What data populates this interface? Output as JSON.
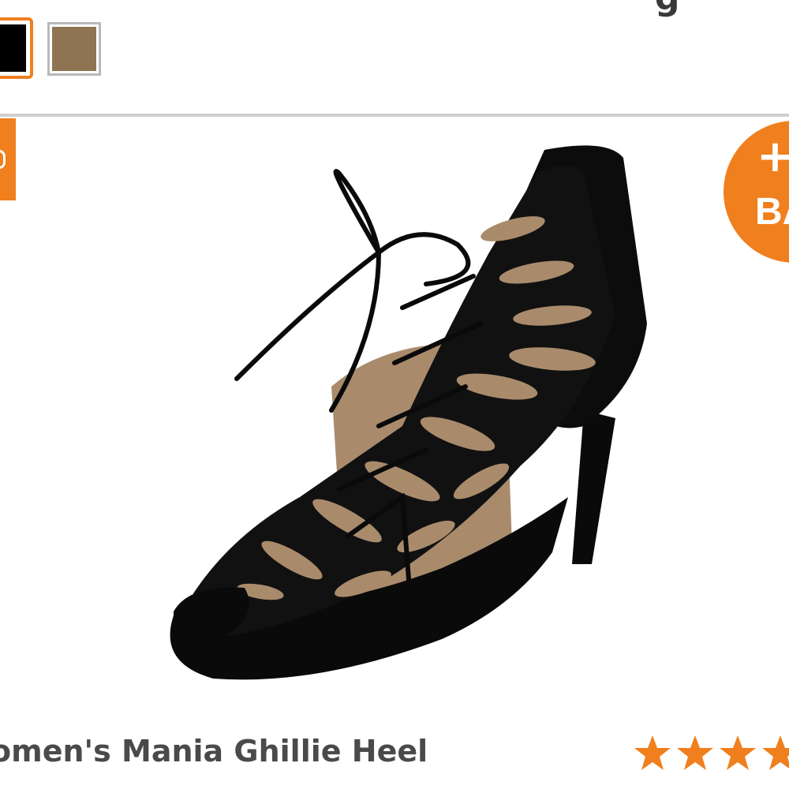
{
  "header": {
    "clipped_title": "g"
  },
  "swatches": [
    {
      "name": "black",
      "color": "#000000",
      "selected": true
    },
    {
      "name": "taupe",
      "color": "#8e7452",
      "selected": false
    }
  ],
  "colors": {
    "accent": "#f07f1e",
    "divider": "#cfcfcf",
    "text": "#4a4a4a"
  },
  "add_to_bag": {
    "plus": "+",
    "label": "BA"
  },
  "product": {
    "name": "omen's Mania Ghillie Heel",
    "image_icon": "black-lace-up-heel-image",
    "rating_stars_visible": 4
  }
}
